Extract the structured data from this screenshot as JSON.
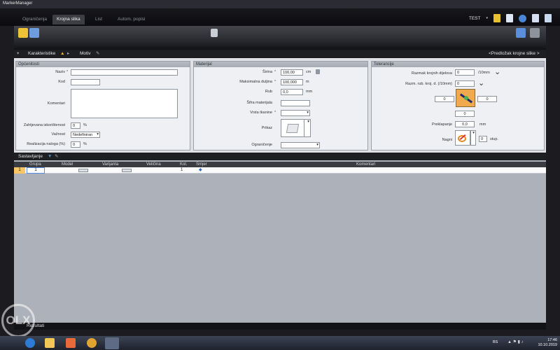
{
  "window": {
    "title": "MarkerManager"
  },
  "tabs": [
    {
      "label": "Ograničenja",
      "active": false
    },
    {
      "label": "Krojna slika",
      "active": true
    },
    {
      "label": "List",
      "active": false
    },
    {
      "label": "Autom. popisi",
      "active": false
    }
  ],
  "user": {
    "label": "TEST"
  },
  "section1": {
    "tab_characteristics": "Karakteristike",
    "tab_motif": "Motiv",
    "preview_link": "<Predložak krojne slike >"
  },
  "panels": {
    "general": {
      "title": "Općenitosti",
      "name_label": "Naziv",
      "code_label": "Kod",
      "comment_label": "Komentari",
      "required_util_label": "Zahtjevana iskorištenost",
      "required_util_value": "0",
      "validity_label": "Važnost",
      "validity_value": "Nedefiniran",
      "realization_label": "Realizacija naloga (%)",
      "realization_value": "0",
      "percent": "%"
    },
    "material": {
      "title": "Materijal",
      "width_label": "Širina",
      "width_value": "100,00",
      "width_unit": "cm",
      "maxlen_label": "Maksimalna duljina",
      "maxlen_value": "100,000",
      "maxlen_unit": "m",
      "edge_label": "Rub",
      "edge_value": "0,0",
      "edge_unit": "mm",
      "code_label": "Šifra materijala",
      "fabric_type_label": "Vrsta tkanine",
      "display_label": "Prikaz",
      "limit_label": "Ograničenje"
    },
    "tolerance": {
      "title": "Tolerancije",
      "spacing_label": "Razmak krojnih dijelova",
      "spacing_value": "0",
      "spacing_unit": "/10mm",
      "edge_dist_label": "Razm. rub. kroj. d. (/10mm)",
      "edge_dist_value": "0",
      "left_value": "0",
      "right_value": "0",
      "bottom_value": "0",
      "overlap_label": "Preklapanje",
      "overlap_value": "0,0",
      "overlap_unit": "mm",
      "tilt_label": "Nagni",
      "tilt_value": "0",
      "tilt_unit": "stup."
    }
  },
  "assembly": {
    "title": "Sastavljanje"
  },
  "grid": {
    "columns": [
      "Grupa",
      "Model",
      "Varijanta",
      "Veličina",
      "Kol.",
      "Smjer",
      "Komentari"
    ],
    "rows": [
      {
        "row_num": "1",
        "group": "1",
        "quantity": "1"
      }
    ]
  },
  "footer": {
    "label": "Rezultati"
  },
  "taskbar": {
    "lang": "BS",
    "time": "17:46",
    "date": "10.10.2019"
  },
  "watermark": {
    "text": "OLX"
  },
  "colors": {
    "accent_orange": "#f5b731",
    "panel_header": "#a6abb3",
    "row_highlight": "#f7c766"
  }
}
